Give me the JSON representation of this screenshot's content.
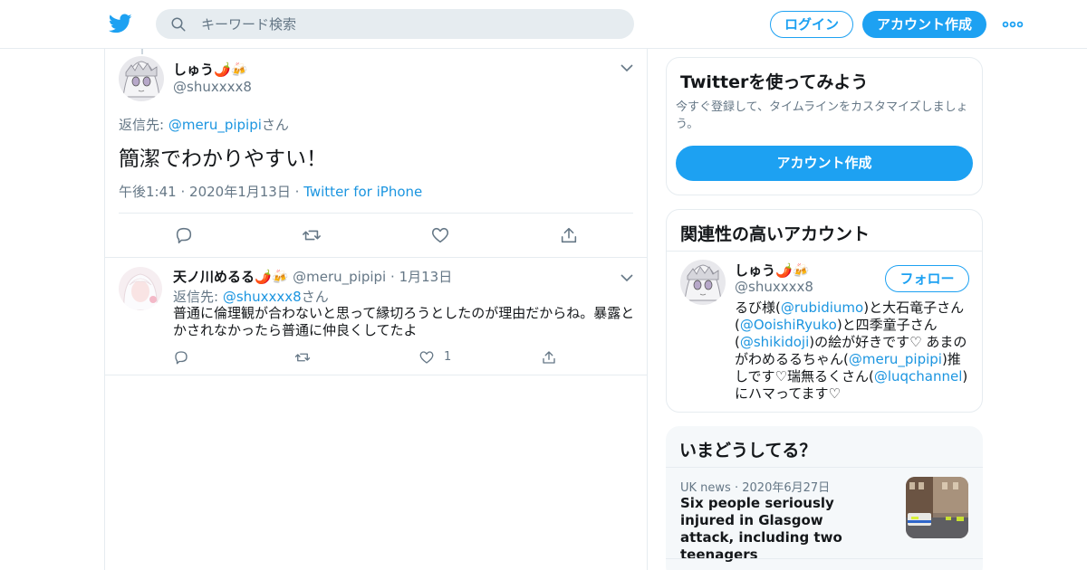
{
  "header": {
    "logo_icon": "twitter-bird-icon",
    "search": {
      "placeholder": "キーワード検索",
      "icon": "search-icon"
    },
    "login_label": "ログイン",
    "signup_label": "アカウント作成",
    "more_icon": "more-dots-icon"
  },
  "colors": {
    "accent": "#1da1f2",
    "link": "#1b95e0",
    "muted": "#657786",
    "border": "#e6ecf0"
  },
  "main_tweet": {
    "name": "しゅう🌶️🍻",
    "handle": "@shuxxxx8",
    "reply_prefix": "返信先: ",
    "reply_handle": "@meru_pipipi",
    "reply_suffix": "さん",
    "text": "簡潔でわかりやすい！",
    "time": "午後1:41",
    "date": "2020年1月13日",
    "source": "Twitter for iPhone",
    "sep": "·",
    "actions": [
      "reply-icon",
      "retweet-icon",
      "like-icon",
      "share-icon"
    ]
  },
  "reply_tweet": {
    "name": "天ノ川めるる🌶️🍻",
    "handle": "@meru_pipipi",
    "sep": "·",
    "date": "1月13日",
    "reply_prefix": "返信先: ",
    "reply_handle": "@shuxxxx8",
    "reply_suffix": "さん",
    "text": "普通に倫理観が合わないと思って縁切ろうとしたのが理由だからね。暴露とかされなかったら普通に仲良くしてたよ",
    "like_count": "1"
  },
  "signup_card": {
    "title": "Twitterを使ってみよう",
    "description": "今すぐ登録して、タイムラインをカスタマイズしましょう。",
    "button": "アカウント作成"
  },
  "related_card": {
    "title": "関連性の高いアカウント",
    "name": "しゅう🌶️🍻",
    "handle": "@shuxxxx8",
    "follow_label": "フォロー",
    "bio": [
      {
        "t": "るび様("
      },
      {
        "t": "@rubidiumo",
        "link": true
      },
      {
        "t": ")と大石竜子さん("
      },
      {
        "t": "@OoishiRyuko",
        "link": true
      },
      {
        "t": ")と四季童子さん("
      },
      {
        "t": "@shikidoji",
        "link": true
      },
      {
        "t": ")の絵が好きです♡ あまのがわめるるちゃん("
      },
      {
        "t": "@meru_pipipi",
        "link": true
      },
      {
        "t": ")推しです♡瑞無るくさん("
      },
      {
        "t": "@luqchannel",
        "link": true
      },
      {
        "t": ")にハマってます♡"
      }
    ]
  },
  "trends_card": {
    "title": "いまどうしてる？",
    "category": "UK news",
    "sep": "·",
    "date": "2020年6月27日",
    "headline": "Six people seriously injured in Glasgow attack, including two teenagers"
  }
}
